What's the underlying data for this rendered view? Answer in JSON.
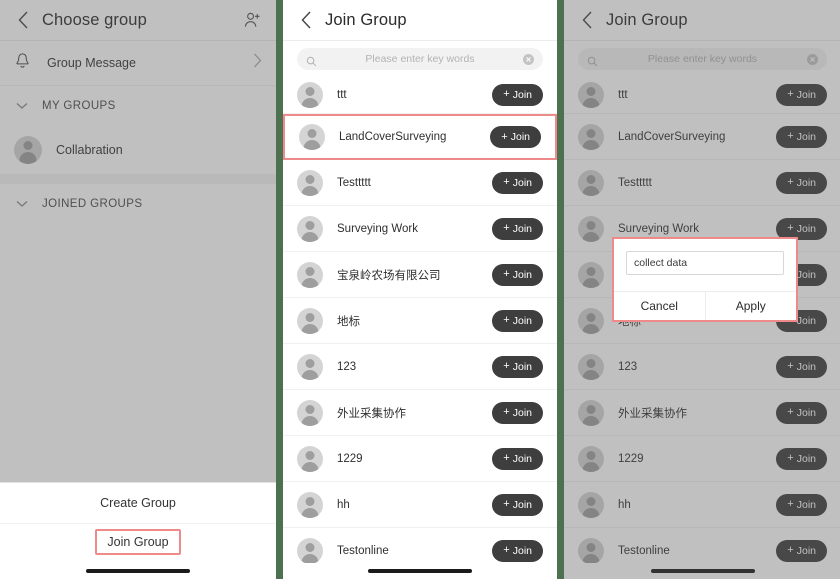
{
  "left_panel": {
    "header": {
      "title": "Choose group",
      "back_icon": "chevron-left-icon",
      "action_icon": "add-person-icon"
    },
    "message_row": {
      "label": "Group Message",
      "icon": "bell-icon",
      "chevron": "chevron-right-icon"
    },
    "sections": [
      {
        "title": "MY GROUPS",
        "caret": "chevron-down-icon",
        "groups": [
          {
            "name": "Collabration"
          }
        ]
      },
      {
        "title": "JOINED GROUPS",
        "caret": "chevron-down-icon",
        "groups": []
      }
    ],
    "sheet": {
      "create_label": "Create Group",
      "join_label": "Join Group"
    }
  },
  "middle_panel": {
    "header": {
      "title": "Join Group",
      "back_icon": "chevron-left-icon"
    },
    "search": {
      "placeholder": "Please enter key words",
      "value": "",
      "search_icon": "search-icon",
      "clear_icon": "clear-circle-icon"
    },
    "join_label": "Join",
    "plus": "+",
    "groups": [
      {
        "name": "ttt",
        "highlighted": false
      },
      {
        "name": "LandCoverSurveying",
        "highlighted": true
      },
      {
        "name": "Testtttt",
        "highlighted": false
      },
      {
        "name": "Surveying Work",
        "highlighted": false
      },
      {
        "name": "宝泉岭农场有限公司",
        "highlighted": false
      },
      {
        "name": "地标",
        "highlighted": false
      },
      {
        "name": "123",
        "highlighted": false
      },
      {
        "name": "外业采集协作",
        "highlighted": false
      },
      {
        "name": "1229",
        "highlighted": false
      },
      {
        "name": "hh",
        "highlighted": false
      },
      {
        "name": "Testonline",
        "highlighted": false
      }
    ]
  },
  "right_panel": {
    "header": {
      "title": "Join Group",
      "back_icon": "chevron-left-icon"
    },
    "search": {
      "placeholder": "Please enter key words",
      "value": "",
      "search_icon": "search-icon",
      "clear_icon": "clear-circle-icon"
    },
    "join_label": "Join",
    "plus": "+",
    "groups": [
      {
        "name": "ttt"
      },
      {
        "name": "LandCoverSurveying"
      },
      {
        "name": "Testtttt"
      },
      {
        "name": "Surveying Work"
      },
      {
        "name": "宝泉岭农场有限公司"
      },
      {
        "name": "地标"
      },
      {
        "name": "123"
      },
      {
        "name": "外业采集协作"
      },
      {
        "name": "1229"
      },
      {
        "name": "hh"
      },
      {
        "name": "Testonline"
      }
    ],
    "dialog": {
      "input_value": "collect data",
      "cancel_label": "Cancel",
      "apply_label": "Apply"
    }
  },
  "colors": {
    "divider_green": "#4c7050",
    "highlight_red": "#ef8a8a",
    "join_button": "#3e3e3e"
  }
}
